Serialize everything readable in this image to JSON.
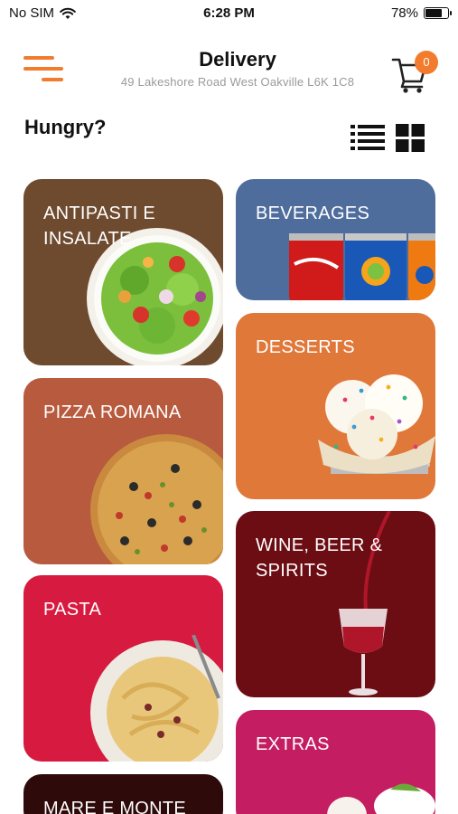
{
  "status_bar": {
    "carrier": "No SIM",
    "time": "6:28 PM",
    "battery_percent": "78%",
    "battery_level": 0.78
  },
  "header": {
    "title": "Delivery",
    "address": "49 Lakeshore Road West   Oakville L6K 1C8",
    "cart_count": "0"
  },
  "section": {
    "greeting": "Hungry?"
  },
  "colors": {
    "accent": "#f27b2d"
  },
  "categories": [
    {
      "label": "ANTIPASTI E INSALATE",
      "color": "#6e4a2f"
    },
    {
      "label": "BEVERAGES",
      "color": "#4f6d9c"
    },
    {
      "label": "DESSERTS",
      "color": "#e0783a"
    },
    {
      "label": "PIZZA ROMANA",
      "color": "#b85a3e"
    },
    {
      "label": "WINE, BEER & SPIRITS",
      "color": "#6b0d13"
    },
    {
      "label": "PASTA",
      "color": "#d71a3f"
    },
    {
      "label": "EXTRAS",
      "color": "#c41d62"
    },
    {
      "label": "MARE E MONTE",
      "color": "#2e0a0a"
    }
  ]
}
